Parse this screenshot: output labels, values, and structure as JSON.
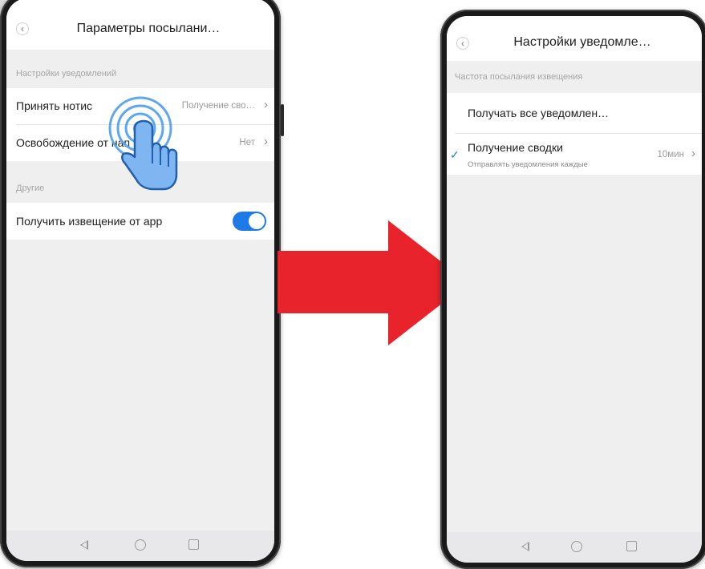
{
  "left_screen": {
    "title": "Параметры посылани…",
    "section_notifications": "Настройки уведомлений",
    "row_receive_label": "Принять нотис",
    "row_receive_value": "Получение сво…",
    "row_free_label": "Освобождение от нап",
    "row_free_value": "Нет",
    "section_other": "Другие",
    "row_app_label": "Получить извещение от app",
    "app_notifications_enabled": true
  },
  "right_screen": {
    "title": "Настройки уведомле…",
    "section_frequency": "Частота посылания извещения",
    "option_all": "Получать все уведомлен…",
    "option_summary": "Получение сводки",
    "option_summary_sub": "Отправлять уведомления каждые",
    "option_summary_value": "10мин",
    "selected_option": "option_summary"
  },
  "glyphs": {
    "back": "‹",
    "chevron": "›",
    "check": "✓"
  },
  "colors": {
    "accent": "#1e7ae6",
    "arrow": "#e8232b",
    "touch": "#5ea6ee"
  },
  "icons": [
    "back-icon",
    "chevron-right-icon",
    "toggle-switch",
    "nav-back-icon",
    "nav-home-icon",
    "nav-recent-icon",
    "check-icon",
    "tap-hand-icon",
    "right-arrow"
  ]
}
